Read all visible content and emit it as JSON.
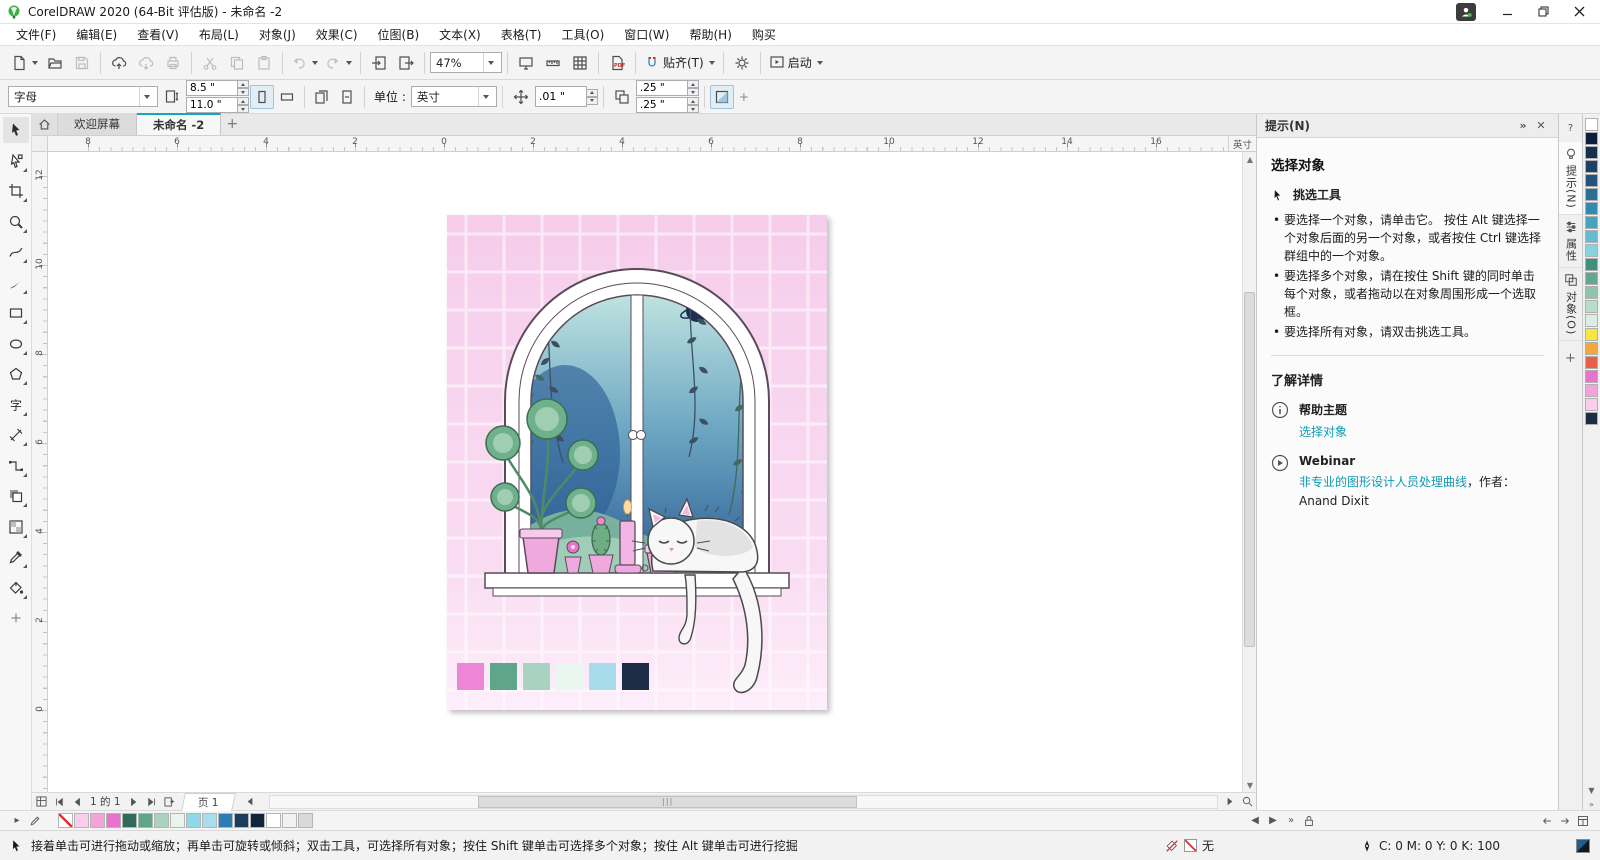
{
  "colors": {
    "accent": "#12a5c6",
    "link": "#0f9bb5"
  },
  "window": {
    "title": "CorelDRAW 2020 (64-Bit 评估版) - 未命名 -2"
  },
  "menu": {
    "items": [
      "文件(F)",
      "编辑(E)",
      "查看(V)",
      "布局(L)",
      "对象(J)",
      "效果(C)",
      "位图(B)",
      "文本(X)",
      "表格(T)",
      "工具(O)",
      "窗口(W)",
      "帮助(H)",
      "购买"
    ]
  },
  "toolbar": {
    "zoom_level": "47%",
    "snap": "贴齐(T)",
    "launch": "启动"
  },
  "propbar": {
    "preset": "字母",
    "page_width": "8.5 \"",
    "page_height": "11.0 \"",
    "units_label": "单位 :",
    "units": "英寸",
    "nudge": ".01 \"",
    "dup_x": ".25 \"",
    "dup_y": ".25 \""
  },
  "doctabs": {
    "welcome": "欢迎屏幕",
    "document": "未命名 -2",
    "new_tab": "+"
  },
  "ruler": {
    "h_labels": [
      "8",
      "6",
      "4",
      "2",
      "0",
      "2",
      "4",
      "6",
      "8",
      "10",
      "12",
      "14",
      "16"
    ],
    "v_labels": [
      "12",
      "10",
      "8",
      "6",
      "4",
      "2",
      "0"
    ],
    "unit": "英寸"
  },
  "toolbox": {
    "tools": [
      "pick",
      "shape",
      "crop",
      "zoom",
      "freehand",
      "artistic-media",
      "rectangle",
      "ellipse",
      "polygon",
      "text",
      "parallel-dimension",
      "connector",
      "drop-shadow",
      "transparency",
      "color-eyedropper",
      "interactive-fill",
      "add-tool"
    ]
  },
  "hints_panel": {
    "title": "提示(N)",
    "heading": "选择对象",
    "tool_name": "挑选工具",
    "bullets": [
      "要选择一个对象，请单击它。 按住 Alt 键选择一个对象后面的另一个对象，或者按住 Ctrl 键选择群组中的一个对象。",
      "要选择多个对象，请在按住 Shift 键的同时单击每个对象，或者拖动以在对象周围形成一个选取框。",
      "要选择所有对象，请双击挑选工具。"
    ],
    "learn_more": "了解详情",
    "help_topics_label": "帮助主题",
    "help_topic_link": "选择对象",
    "webinar_label": "Webinar",
    "webinar_link": "非专业的图形设计人员处理曲线",
    "webinar_byline": "，作者：",
    "webinar_author": "Anand Dixit"
  },
  "docker_tabs": {
    "hints": "提示(N)",
    "properties": "属性",
    "objects": "对象(O)"
  },
  "page_nav": {
    "page_info": "1 的 1",
    "page_tab": "页 1"
  },
  "status_bar": {
    "message": "接着单击可进行拖动或缩放；再单击可旋转或倾斜；双击工具，可选择所有对象；按住 Shift 键单击可选择多个对象；按住 Alt 键单击可进行挖掘",
    "fill_label": "无",
    "outline_value": "C: 0 M: 0 Y: 0 K: 100"
  },
  "artwork": {
    "palette_swatches": [
      "#ee86d6",
      "#5ea58a",
      "#a9d3c1",
      "#eaf6f0",
      "#a8dcec",
      "#1b2c44"
    ]
  },
  "document_palette": [
    "none",
    "#f9cdeb",
    "#f2a3da",
    "#e972cc",
    "#2f6b5a",
    "#5ea58a",
    "#a9d3c1",
    "#e8f5ef",
    "#8fd8e8",
    "#a9dcec",
    "#2a7db5",
    "#1c3c5e",
    "#12233c",
    "#ffffff",
    "#f2f2f2",
    "#d9d9d9"
  ],
  "color_palette": [
    "#ffffff",
    "#0d1f3c",
    "#14304f",
    "#1b4265",
    "#23557b",
    "#2a6f94",
    "#3189ad",
    "#45a3c0",
    "#63bcd0",
    "#86d2dd",
    "#3f8f7a",
    "#63a88e",
    "#8fc4ad",
    "#b8dcc9",
    "#dceee4",
    "#f5e642",
    "#f2a83b",
    "#e8604a",
    "#e972cc",
    "#f2a3da",
    "#f9cdeb",
    "#1b2c44"
  ]
}
